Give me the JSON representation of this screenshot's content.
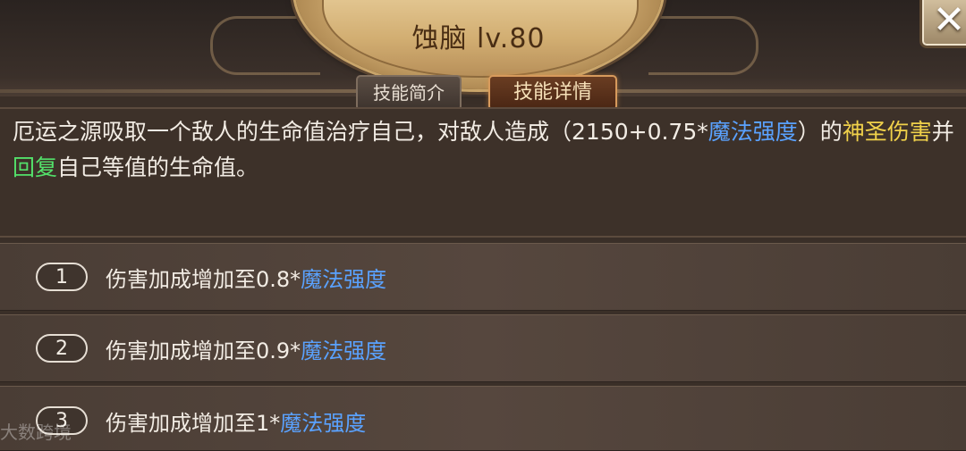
{
  "skill": {
    "name": "蚀脑",
    "level": "lv.80"
  },
  "tabs": {
    "intro": "技能简介",
    "detail": "技能详情"
  },
  "close_icon": "close-x-icon",
  "description": {
    "part1": "厄运之源吸取一个敌人的生命值治疗自己，对敌人造成（2150+0.75*",
    "stat": "魔法强度",
    "part2": "）的",
    "holy_damage": "神圣伤害",
    "part3": "并",
    "heal": "回复",
    "part4": "自己等值的生命值。"
  },
  "upgrades": [
    {
      "num": "1",
      "text": "伤害加成增加至0.8*",
      "stat": "魔法强度"
    },
    {
      "num": "2",
      "text": "伤害加成增加至0.9*",
      "stat": "魔法强度"
    },
    {
      "num": "3",
      "text": "伤害加成增加至1*",
      "stat": "魔法强度"
    }
  ],
  "watermark": "大数跨境",
  "colors": {
    "stat_blue": "#5aa2ff",
    "holy_yellow": "#f0d14a",
    "heal_green": "#53e06a"
  }
}
